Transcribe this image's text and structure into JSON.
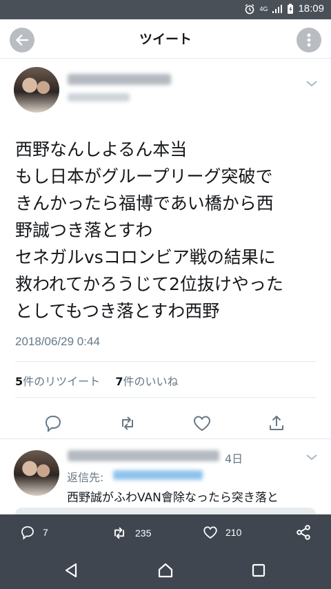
{
  "status_bar": {
    "time": "18:09",
    "network": "4G"
  },
  "header": {
    "title": "ツイート"
  },
  "tweet": {
    "lines": [
      "西野なんしよるん本当",
      "もし日本がグループリーグ突破で",
      "きんかったら福博であい橋から西",
      "野誠つき落とすわ",
      "セネガルvsコロンビア戦の結果に",
      "救われてかろうじて2位抜けやった",
      "としてもつき落とすわ西野"
    ],
    "timestamp": "2018/06/29 0:44",
    "retweet_count": "5",
    "retweet_label": "件のリツイート",
    "like_count": "7",
    "like_label": "件のいいね"
  },
  "reply": {
    "time": "4日",
    "reply_to_label": "返信先:",
    "text": "西野誠がふわVAN會除なったら突き落と"
  },
  "bottom_bar": {
    "reply_count": "7",
    "retweet_count": "235",
    "like_count": "210"
  },
  "colors": {
    "accent": "#1da1f2",
    "bar": "#3f4650",
    "muted": "#657786"
  },
  "icons": [
    "back-arrow-icon",
    "more-vertical-icon",
    "chevron-down-icon",
    "reply-icon",
    "retweet-icon",
    "heart-icon",
    "share-icon",
    "back-triangle-icon",
    "home-icon",
    "recents-icon"
  ]
}
